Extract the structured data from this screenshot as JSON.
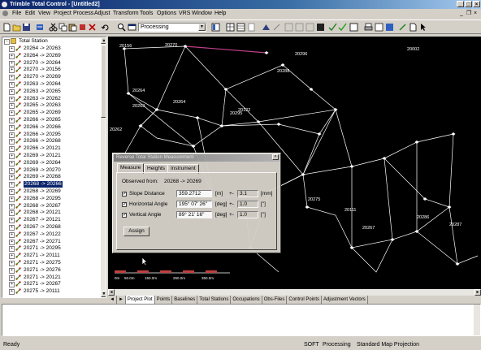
{
  "window": {
    "title": "Trimble Total Control - [Untitled2]",
    "min": "_",
    "max": "□",
    "close": "×"
  },
  "menu": {
    "items": [
      "File",
      "Edit",
      "View",
      "Project",
      "Process",
      "Adjust",
      "Transform",
      "Tools",
      "Options",
      "VRS",
      "Window",
      "Help"
    ],
    "mdi_min": "_",
    "mdi_restore": "❐",
    "mdi_close": "×"
  },
  "toolbar": {
    "mode_combo": "Processing"
  },
  "tree": {
    "root_label": "Total Station",
    "items": [
      "20264 -> 20263",
      "20264 -> 20269",
      "20270 -> 20264",
      "20270 -> 20156",
      "20270 -> 20269",
      "20263 -> 20264",
      "20263 -> 20265",
      "20263 -> 20262",
      "20265 -> 20263",
      "20265 -> 20269",
      "20266 -> 20265",
      "20266 -> 20266",
      "20266 -> 20295",
      "20266 -> 20268",
      "20266 -> 20121",
      "20269 -> 20121",
      "20269 -> 20264",
      "20269 -> 20270",
      "20269 -> 20268",
      "20268 -> 20266",
      "20268 -> 20269",
      "20268 -> 20295",
      "20268 -> 20267",
      "20268 -> 20121",
      "20267 -> 20121",
      "20267 -> 20268",
      "20267 -> 20122",
      "20267 -> 20271",
      "20271 -> 20295",
      "20271 -> 20111",
      "20271 -> 20275",
      "20271 -> 20276",
      "20271 -> 20121",
      "20271 -> 20267",
      "20275 -> 20111"
    ],
    "selected_index": 19,
    "expander": "+"
  },
  "plot": {
    "labels": [
      {
        "text": "20156"
      },
      {
        "text": "20270"
      },
      {
        "text": "20296"
      },
      {
        "text": "20002"
      },
      {
        "text": "20288"
      },
      {
        "text": "20264"
      },
      {
        "text": "20263"
      },
      {
        "text": "20264"
      },
      {
        "text": "20295"
      },
      {
        "text": "20122"
      },
      {
        "text": "20262"
      },
      {
        "text": "20275"
      },
      {
        "text": "20111"
      },
      {
        "text": "20267"
      },
      {
        "text": "20286"
      },
      {
        "text": "20287"
      }
    ],
    "scale_labels": [
      "0m",
      "50.0m",
      "150.0m",
      "250.0m",
      "350.0m"
    ]
  },
  "bottom_tabs": [
    "Project Plot",
    "Points",
    "Baselines",
    "Total Stations",
    "Occupations",
    "Obs-Files",
    "Control Points",
    "Adjustment Vectors"
  ],
  "dialog": {
    "title": "Reverse Total Station Measurement",
    "close": "×",
    "tabs": [
      "Measure",
      "Heights",
      "Instrument"
    ],
    "observed_label": "Observed from:",
    "observed_value": "20268 -> 20269",
    "rows": [
      {
        "check": "✓",
        "label": "Slope Distance",
        "value": "359.2712",
        "unit": "[m]",
        "pm": "+-",
        "sigma": "3.1",
        "sigma_unit": "[mm]"
      },
      {
        "check": "✓",
        "label": "Horizontal Angle",
        "value": "195° 07' 26\"",
        "unit": "[deg]",
        "pm": "+-",
        "sigma": "1.0",
        "sigma_unit": "[\"]"
      },
      {
        "check": "✓",
        "label": "Vertical Angle",
        "value": "89° 21' 16\"",
        "unit": "[deg]",
        "pm": "+-",
        "sigma": "1.0",
        "sigma_unit": "[\"]"
      }
    ],
    "assign_label": "Assign"
  },
  "status": {
    "left": "Ready",
    "mode1": "SOFT",
    "mode2": "Processing",
    "projection": "Standard Map Projection"
  },
  "colors": {
    "title_bar": "#0a246a",
    "plot_bg": "#000000",
    "vector_line": "#ffffff",
    "highlight_vector": "#c0408a",
    "selection": "#0a246a"
  }
}
